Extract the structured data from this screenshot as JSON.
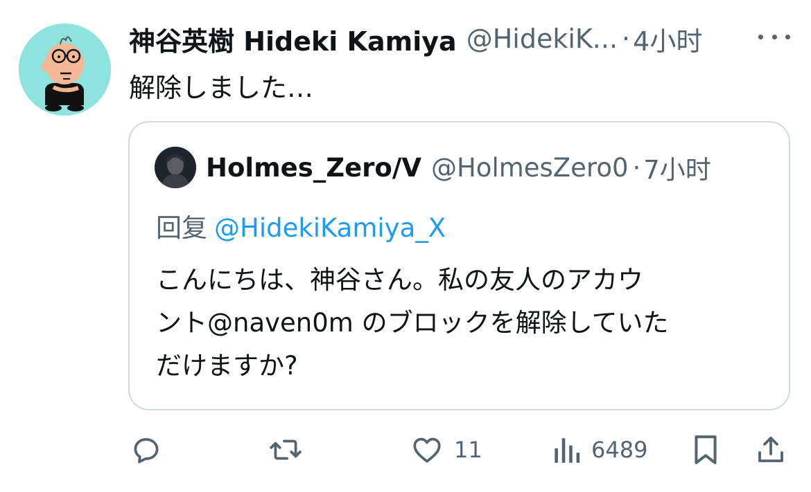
{
  "tweet": {
    "author_name": "神谷英樹 Hideki Kamiya",
    "author_handle": "@HidekiK...",
    "separator": "·",
    "time": "4小时",
    "text": "解除しました…"
  },
  "quote": {
    "author_name": "Holmes_Zero/V",
    "author_handle": "@HolmesZero0",
    "separator": "·",
    "time": "7小时",
    "reply_prefix": "回复",
    "reply_to": "@HidekiKamiya_X",
    "text_lines": [
      "こんにちは、神谷さん。私の友人のアカウ",
      "ント@naven0m のブロックを解除していた",
      "だけますか?"
    ]
  },
  "actions": {
    "reply_icon": "reply-icon",
    "retweet_icon": "retweet-icon",
    "like_icon": "heart-icon",
    "like_count": "11",
    "views_icon": "views-icon",
    "views_count": "6489",
    "bookmark_icon": "bookmark-icon",
    "share_icon": "share-icon"
  },
  "colors": {
    "text": "#0f1419",
    "secondary": "#536471",
    "link": "#1d9bf0",
    "border": "#cfd9de",
    "avatar_bg": "#8fe3de"
  }
}
